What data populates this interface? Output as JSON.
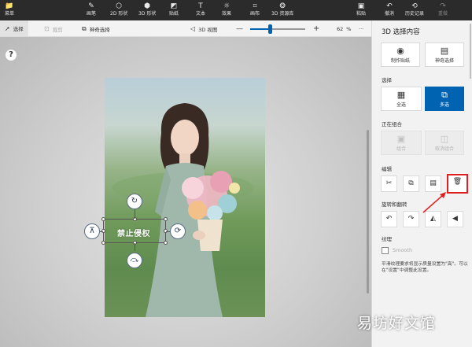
{
  "toolbar": {
    "items": [
      {
        "label": "菜单",
        "icon": "menu-icon"
      },
      {
        "label": "画笔",
        "icon": "brush-icon"
      },
      {
        "label": "2D 形状",
        "icon": "2d-shape-icon"
      },
      {
        "label": "3D 形状",
        "icon": "3d-shape-icon"
      },
      {
        "label": "贴纸",
        "icon": "sticker-icon"
      },
      {
        "label": "文本",
        "icon": "text-icon"
      },
      {
        "label": "效果",
        "icon": "effects-icon"
      },
      {
        "label": "画布",
        "icon": "canvas-icon"
      },
      {
        "label": "3D 资源库",
        "icon": "3d-library-icon"
      },
      {
        "label": "粘贴",
        "icon": "paste-icon"
      },
      {
        "label": "撤消",
        "icon": "undo-icon"
      },
      {
        "label": "历史记录",
        "icon": "history-icon"
      },
      {
        "label": "重做",
        "icon": "redo-icon"
      }
    ]
  },
  "subtoolbar": {
    "select": "选择",
    "crop": "裁剪",
    "magic_select": "神奇选择",
    "view_3d": "3D 视图",
    "zoom_percent": "62",
    "zoom_unit": "%",
    "more": "···",
    "zoom_level": 0.35
  },
  "canvas": {
    "help": "?",
    "sticker_text": "禁止侵权"
  },
  "panel": {
    "title": "3D 选择内容",
    "make_sticker": "制作贴纸",
    "magic_select": "神奇选择",
    "section_select": "选择",
    "select_all": "全选",
    "multi_select": "多选",
    "section_combining": "正在组合",
    "group": "组合",
    "ungroup": "取消组合",
    "section_edit": "编辑",
    "section_rotate": "旋转和翻转",
    "section_texture": "纹理",
    "smooth": "Smooth",
    "description": "平滑纹理要求将显示质量设置为\"高\"。可以在\"设置\"中调整此设置。"
  },
  "watermark": "易坊好文馆",
  "colors": {
    "accent": "#0063b1",
    "highlight": "#e02020",
    "topbar": "#2b2b2b"
  }
}
